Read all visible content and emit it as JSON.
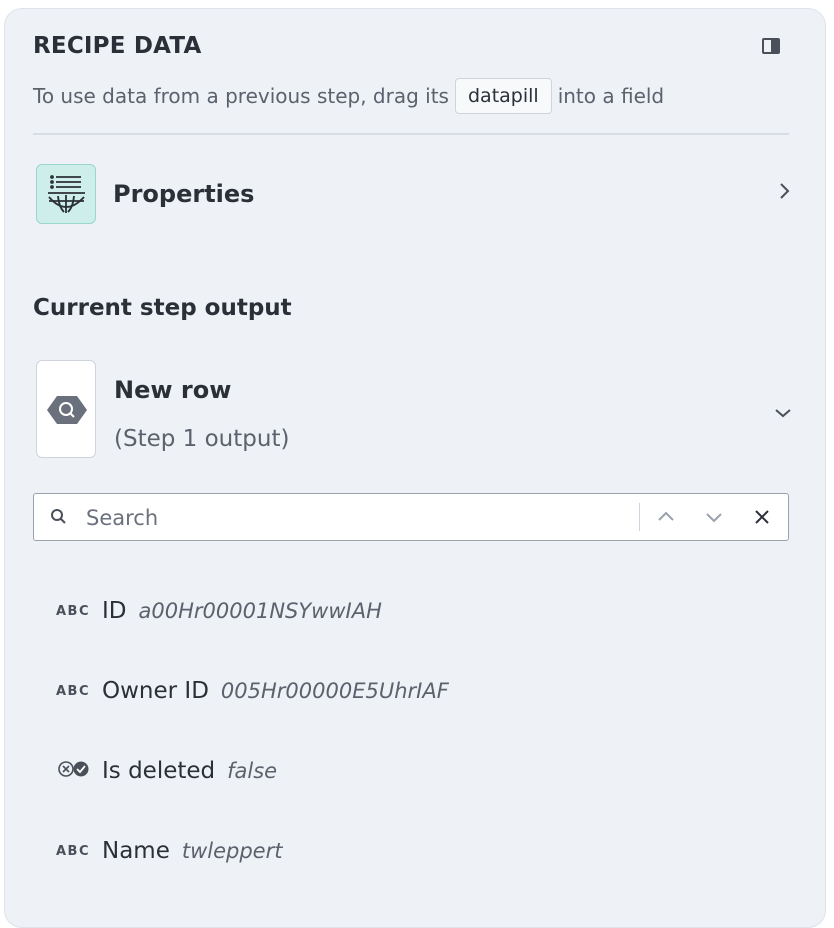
{
  "header": {
    "title": "RECIPE DATA",
    "hint_before": "To use data from a previous step, drag its",
    "hint_pill": "datapill",
    "hint_after": "into a field"
  },
  "properties": {
    "label": "Properties"
  },
  "current_step": {
    "section_title": "Current step output",
    "step_title": "New row",
    "step_subtitle": "(Step 1 output)"
  },
  "search": {
    "placeholder": "Search",
    "value": ""
  },
  "fields": [
    {
      "type": "string",
      "type_label": "ABC",
      "name": "ID",
      "value": "a00Hr00001NSYwwIAH"
    },
    {
      "type": "string",
      "type_label": "ABC",
      "name": "Owner ID",
      "value": "005Hr00000E5UhrIAF"
    },
    {
      "type": "boolean",
      "type_label": "",
      "name": "Is deleted",
      "value": "false"
    },
    {
      "type": "string",
      "type_label": "ABC",
      "name": "Name",
      "value": "twleppert"
    }
  ],
  "colors": {
    "panel_bg": "#eef2f7",
    "properties_icon_bg": "#cdeee9",
    "text_primary": "#2b2f38",
    "text_secondary": "#5b616d"
  },
  "icons": {
    "collapse": "panel-collapse-icon",
    "properties": "list-globe-icon",
    "step": "bigquery-hexagon-icon",
    "search": "search-icon",
    "prev": "chevron-up-icon",
    "next": "chevron-down-icon",
    "clear": "close-icon"
  }
}
